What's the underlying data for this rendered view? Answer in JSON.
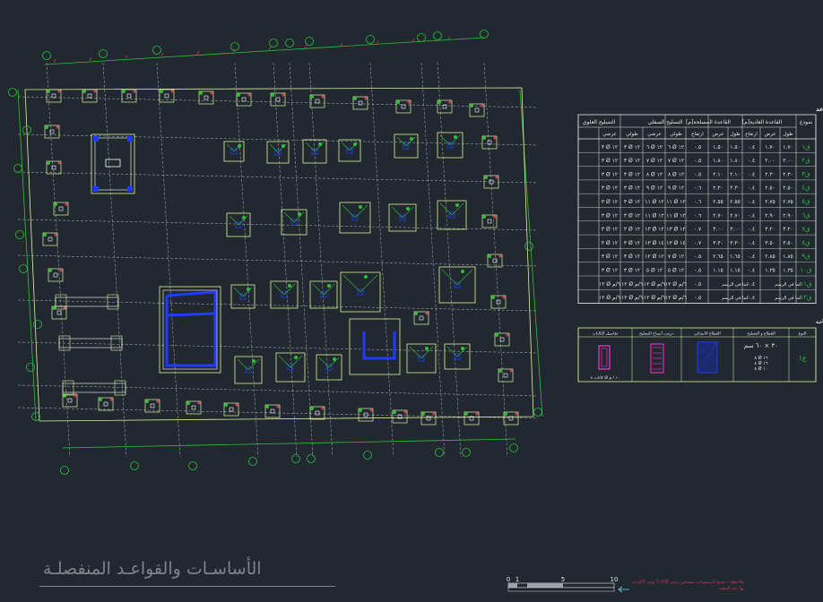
{
  "drawing_title": "الأساسـات والقواعـد المنفصلـة",
  "colors": {
    "background": "#212830",
    "grid": "#b8b8b8",
    "outline": "#e8f0a0",
    "column": "#ffffff",
    "dim": "#c23a5c",
    "green": "#2fbf3a",
    "blue": "#1e3cff",
    "table_text": "#e8e8e8",
    "magenta": "#ff2fd0"
  },
  "footings_table": {
    "title": "نماذج القواعد و تسليح القواعد",
    "header": [
      "نموذج",
      "القاعدة العادية[م]",
      "القاعدة المسلحة[م]",
      "التسليح السفلي",
      "التسليح العلوي"
    ],
    "subheader": [
      "طول",
      "عرض",
      "ارتفاع",
      "طول",
      "عرض",
      "ارتفاع",
      "طولي",
      "عرضي",
      "طولي",
      "عرضي"
    ],
    "rows": [
      [
        "ق١",
        "١.٧٠",
        "١.٧٠",
        "٠.٤",
        "١.٥٠",
        "١.٥٠",
        "٠.٥",
        "٦ Ø ١٢",
        "٦ Ø ١٢",
        "٣ Ø ١٢",
        "٣ Ø ١٢"
      ],
      [
        "ق٢",
        "٢.٠٠",
        "٢.٠٠",
        "٠.٤",
        "١.٨٠",
        "١.٨٠",
        "٠.٥",
        "٧ Ø ١٢",
        "٧ Ø ١٢",
        "٣ Ø ١٢",
        "٣ Ø ١٢"
      ],
      [
        "ق٣",
        "٢.٣٠",
        "٢.٣٠",
        "٠.٤",
        "٢.١٠",
        "٢.١٠",
        "٠.٥",
        "٨ Ø ١٢",
        "٨ Ø ١٢",
        "٣ Ø ١٢",
        "٣ Ø ١٢"
      ],
      [
        "ق٤",
        "٢.٥٠",
        "٢.٥٠",
        "٠.٤",
        "٢.٣٠",
        "٢.٣٠",
        "٠.٦",
        "٩ Ø ١٢",
        "٩ Ø ١٢",
        "٣ Ø ١٢",
        "٣ Ø ١٢"
      ],
      [
        "ق٥",
        "٢.٧٥",
        "٢.٧٥",
        "٠.٤",
        "٢.٥٥",
        "٢.٥٥",
        "٠.٦",
        "١١ Ø ١٢",
        "١١ Ø ١٢",
        "٣ Ø ١٢",
        "٣ Ø ١٢"
      ],
      [
        "ق٦",
        "٢.٩٠",
        "٢.٩٠",
        "٠.٤",
        "٢.٧٠",
        "٢.٧٠",
        "٠.٦",
        "١١ Ø ١٢",
        "١١ Ø ١٢",
        "٣ Ø ١٢",
        "٣ Ø ١٢"
      ],
      [
        "ق٧",
        "٣.٢٠",
        "٣.٢٠",
        "٠.٤",
        "٣.٠٠",
        "٣.٠٠",
        "٠.٧",
        "١٣ Ø ١٢",
        "١٣ Ø ١٢",
        "٣ Ø ١٢",
        "٣ Ø ١٢"
      ],
      [
        "ق٨",
        "٣.٥٠",
        "٣.٥٠",
        "٠.٤",
        "٣.٣٠",
        "٣.٣٠",
        "٠.٧",
        "١٣ Ø ١٤",
        "١٣ Ø ١٤",
        "٣ Ø ١٢",
        "٣ Ø ١٢"
      ],
      [
        "ق٩",
        "١.٨٥",
        "٢.٨٥",
        "٠.٤",
        "١.٦٥",
        "٢.٦٥",
        "٠.٥",
        "٧ Ø ١٢",
        "١٢ Ø ١٢",
        "٣ Ø ١٢",
        "٣ Ø ١٢"
      ],
      [
        "ق١٠",
        "١.٣٥",
        "١.٣٥",
        "٠.٤",
        "١.١٥",
        "١.١٥",
        "٠.٥",
        "٥ Ø ١٢",
        "٥ Ø ١٢",
        "٣ Ø ١٢",
        "٣ Ø ١٢"
      ],
      [
        "ق١١",
        "كما في الرسم",
        "",
        "٠.٤",
        "كما في الرسم",
        "",
        "٠.٥",
        "١٢ Ø ٦/م",
        "١٢ Ø ٦/م",
        "١٢ Ø ٦/م",
        "١٢ Ø ٦/م"
      ],
      [
        "ق١٢",
        "كما في الرسم",
        "",
        "٠.٤",
        "كما في الرسم",
        "",
        "٠.٥",
        "١٢ Ø ٦/م",
        "١٢ Ø ٦/م",
        "١٢ Ø ٦/م",
        "١٢ Ø ٦/م"
      ]
    ]
  },
  "columns_table": {
    "title": "نماذج القطاعات و تسليح القطاعات",
    "header": [
      "النوع",
      "القطاع و التسليح",
      "القطاع الانشائي",
      "ترتيب أسياخ التسليح",
      "تفاصيل الكانات"
    ],
    "row_type": "ع١",
    "row_section": "٣٠ × ٦٠ سم",
    "row_bars": [
      "٨ Ø ١٦",
      "٤ Ø ١٦",
      "٨ Ø ١٠"
    ],
    "stirrups_note": "كانات ٨ Ø ١٠ / م"
  },
  "scale_bar": {
    "labels": [
      "0",
      "1",
      "5",
      "10"
    ]
  },
  "note": "ملاحظة : جميع الرسومات بمقياس رسم 1:100 ويتم الالتزام بها عند التنفيذ"
}
